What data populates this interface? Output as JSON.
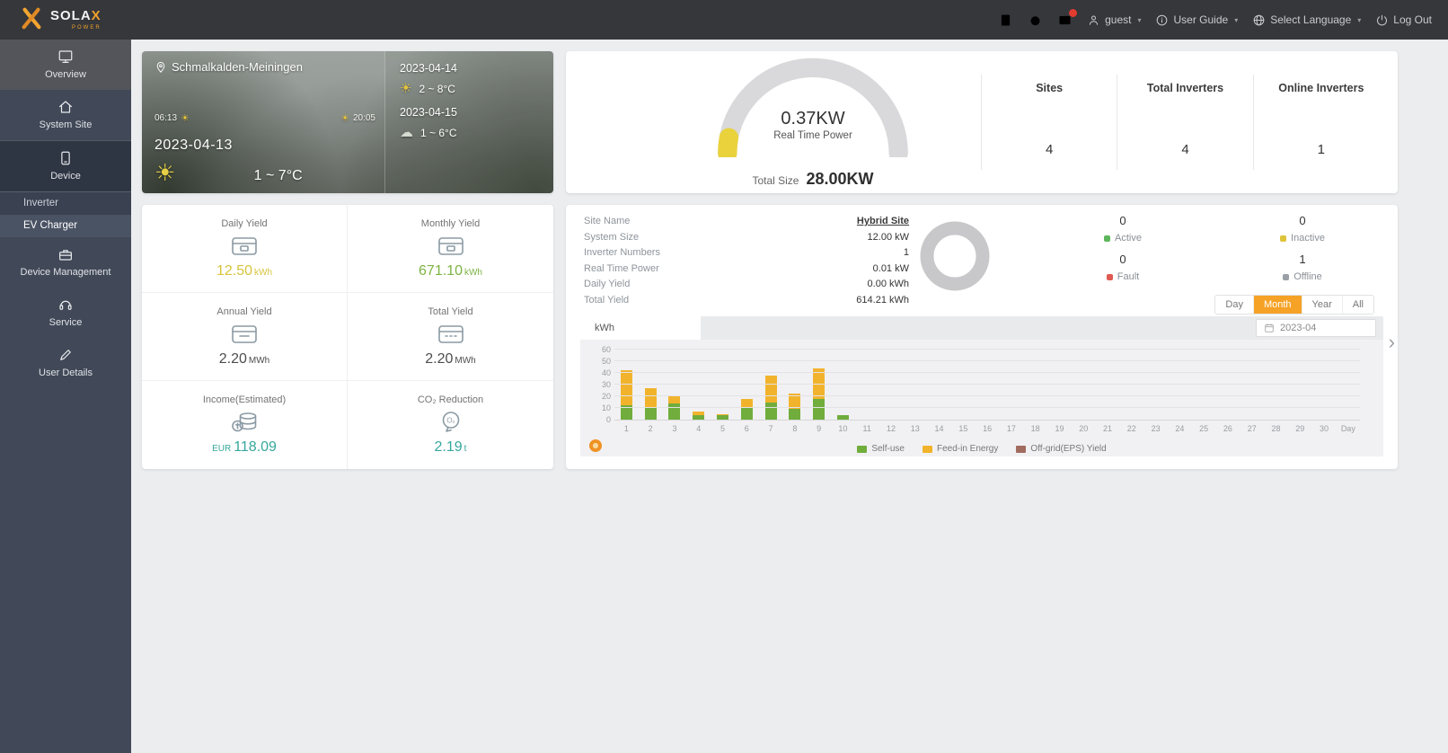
{
  "icons": {
    "next_arrow": "›",
    "sun": "☀",
    "cloud": "☁",
    "caret": "▾"
  },
  "topbar": {
    "brand": "SOLA",
    "brand_x": "X",
    "brand_sub": "POWER",
    "user": "guest",
    "user_guide": "User Guide",
    "select_language": "Select Language",
    "logout": "Log Out"
  },
  "sidebar": {
    "items": [
      {
        "label": "Overview",
        "icon": "monitor",
        "type": "item",
        "light": true
      },
      {
        "label": "System Site",
        "icon": "house",
        "type": "item"
      },
      {
        "label": "Device",
        "icon": "device",
        "type": "item",
        "active": true
      },
      {
        "label": "Inverter",
        "type": "sub"
      },
      {
        "label": "EV Charger",
        "type": "sub",
        "highlight": true
      },
      {
        "label": "Device Management",
        "icon": "toolbox",
        "type": "item"
      },
      {
        "label": "Service",
        "icon": "headset",
        "type": "item"
      },
      {
        "label": "User Details",
        "icon": "pencil",
        "type": "item"
      }
    ]
  },
  "weather": {
    "location": "Schmalkalden-Meiningen",
    "sunrise": "06:13",
    "sunset": "20:05",
    "date": "2023-04-13",
    "temp": "1 ~ 7°C",
    "forecasts": [
      {
        "date": "2023-04-14",
        "temp": "2 ~ 8°C",
        "icon": "sun"
      },
      {
        "date": "2023-04-15",
        "temp": "1 ~ 6°C",
        "icon": "cloud"
      }
    ]
  },
  "power": {
    "value": "0.37KW",
    "caption": "Real Time Power",
    "total_label": "Total Size",
    "total_value": "28.00KW",
    "stats": [
      {
        "label": "Sites",
        "value": "4"
      },
      {
        "label": "Total Inverters",
        "value": "4"
      },
      {
        "label": "Online Inverters",
        "value": "1"
      }
    ]
  },
  "yields": {
    "cells": [
      {
        "label": "Daily Yield",
        "value": "12.50",
        "unit": "kWh",
        "color": "#d8c43c",
        "icon": "daily"
      },
      {
        "label": "Monthly Yield",
        "value": "671.10",
        "unit": "kWh",
        "color": "#7cb342",
        "icon": "monthly"
      },
      {
        "label": "Annual Yield",
        "value": "2.20",
        "unit": "MWh",
        "color": "#4d4d4d",
        "icon": "annual"
      },
      {
        "label": "Total Yield",
        "value": "2.20",
        "unit": "MWh",
        "color": "#4d4d4d",
        "icon": "total"
      },
      {
        "label": "Income(Estimated)",
        "prefix": "EUR",
        "value": "118.09",
        "unit": "",
        "color": "#35a79c",
        "icon": "income"
      },
      {
        "label": "CO₂ Reduction",
        "value": "2.19",
        "unit": "t",
        "color": "#35a79c",
        "icon": "co2"
      }
    ]
  },
  "site": {
    "info": [
      {
        "label": "Site Name",
        "value": "Hybrid Site",
        "link": true
      },
      {
        "label": "System Size",
        "value": "12.00 kW"
      },
      {
        "label": "Inverter Numbers",
        "value": "1"
      },
      {
        "label": "Real Time Power",
        "value": "0.01 kW"
      },
      {
        "label": "Daily Yield",
        "value": "0.00 kWh"
      },
      {
        "label": "Total Yield",
        "value": "614.21 kWh"
      }
    ],
    "statuses": [
      {
        "label": "Active",
        "count": "0",
        "color": "#5fb75d"
      },
      {
        "label": "Inactive",
        "count": "0",
        "color": "#ddc43a"
      },
      {
        "label": "Fault",
        "count": "0",
        "color": "#df5a52"
      },
      {
        "label": "Offline",
        "count": "1",
        "color": "#9aa0a6"
      }
    ],
    "periods": [
      "Day",
      "Month",
      "Year",
      "All"
    ],
    "active_period": "Month",
    "chart_tab": "kWh",
    "date": "2023-04"
  },
  "chart_data": {
    "type": "bar",
    "stacked": true,
    "title": "",
    "xlabel": "Day",
    "ylabel": "kWh",
    "x": [
      1,
      2,
      3,
      4,
      5,
      6,
      7,
      8,
      9,
      10,
      11,
      12,
      13,
      14,
      15,
      16,
      17,
      18,
      19,
      20,
      21,
      22,
      23,
      24,
      25,
      26,
      27,
      28,
      29,
      30
    ],
    "ylim": [
      0,
      60
    ],
    "yticks": [
      0,
      10,
      20,
      30,
      40,
      50,
      60
    ],
    "grid": true,
    "legend_position": "bottom",
    "series": [
      {
        "name": "Self-use",
        "color": "#70ad3c",
        "values": [
          12,
          11,
          14,
          4,
          4,
          10,
          15,
          9,
          18,
          4,
          0,
          0,
          0,
          0,
          0,
          0,
          0,
          0,
          0,
          0,
          0,
          0,
          0,
          0,
          0,
          0,
          0,
          0,
          0,
          0
        ]
      },
      {
        "name": "Feed-in Energy",
        "color": "#f2b32c",
        "values": [
          30,
          16,
          6,
          3,
          1,
          8,
          23,
          13,
          26,
          0,
          0,
          0,
          0,
          0,
          0,
          0,
          0,
          0,
          0,
          0,
          0,
          0,
          0,
          0,
          0,
          0,
          0,
          0,
          0,
          0
        ]
      },
      {
        "name": "Off-grid(EPS) Yield",
        "color": "#a26b5f",
        "values": [
          0,
          0,
          0,
          0,
          0,
          0,
          0,
          0,
          0,
          0,
          0,
          0,
          0,
          0,
          0,
          0,
          0,
          0,
          0,
          0,
          0,
          0,
          0,
          0,
          0,
          0,
          0,
          0,
          0,
          0
        ]
      }
    ]
  }
}
